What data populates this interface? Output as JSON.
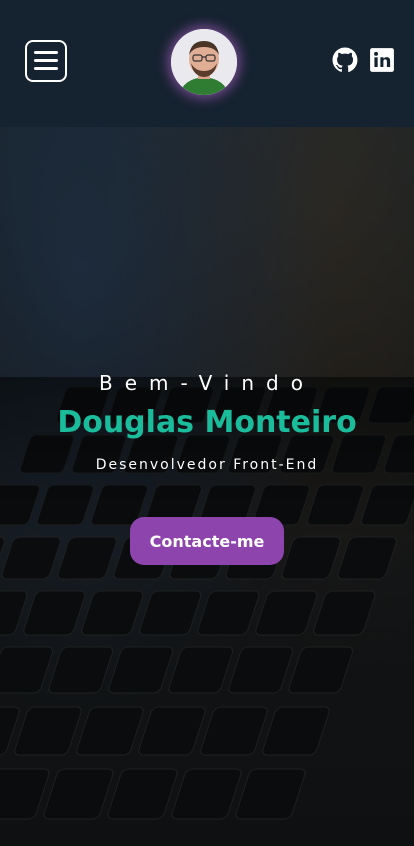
{
  "header": {
    "menu_icon": "hamburger-icon",
    "avatar_alt": "Douglas Monteiro",
    "social": [
      {
        "name": "github",
        "icon": "github-icon"
      },
      {
        "name": "linkedin",
        "icon": "linkedin-icon"
      }
    ]
  },
  "hero": {
    "welcome": "Bem-Vindo",
    "name": "Douglas Monteiro",
    "role": "Desenvolvedor Front-End",
    "cta_label": "Contacte-me"
  },
  "colors": {
    "header_bg": "#15222f",
    "accent_green": "#1abc9c",
    "accent_purple": "#8e44ad",
    "text": "#ffffff"
  }
}
